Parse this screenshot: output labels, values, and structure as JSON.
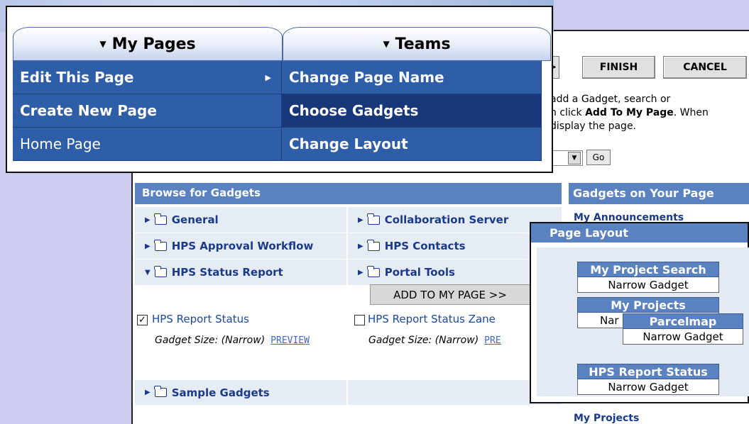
{
  "menu": {
    "tabs": [
      "My Pages",
      "Teams"
    ],
    "left_items": [
      "Edit This Page",
      "Create New Page",
      "Home Page"
    ],
    "right_items": [
      "Change Page Name",
      "Choose Gadgets",
      "Change Layout"
    ]
  },
  "wizard": {
    "back_partial": ">",
    "finish": "FINISH",
    "cancel": "CANCEL",
    "instructions_line1": "add a Gadget, search or",
    "instructions_line2a": "n click ",
    "instructions_line2b": "Add To My Page",
    "instructions_line2c": ". When",
    "instructions_line3": "display the page.",
    "go": "Go"
  },
  "browse": {
    "header": "Browse for Gadgets",
    "categories_left": [
      "General",
      "HPS Approval Workflow",
      "HPS Status Report"
    ],
    "categories_right": [
      "Collaboration Server",
      "HPS Contacts",
      "Portal Tools"
    ],
    "add_button": "ADD TO MY PAGE >>",
    "gadgets": [
      {
        "title": "HPS Report Status",
        "size": "Gadget Size: (Narrow)",
        "preview": "PREVIEW",
        "checked": true
      },
      {
        "title": "HPS Report Status Zane",
        "size": "Gadget Size: (Narrow)",
        "preview": "PRE",
        "checked": false
      }
    ],
    "sample": "Sample Gadgets"
  },
  "right_panel": {
    "header": "Gadgets on Your Page",
    "top_link": "My Announcements",
    "bottom_link": "My Projects"
  },
  "layout_popup": {
    "header": "Page Layout",
    "boxes": [
      {
        "title": "My Project Search",
        "sub": "Narrow Gadget"
      },
      {
        "title": "My Projects",
        "sub": "Nar"
      },
      {
        "title": "Parcelmap",
        "sub": "Narrow Gadget"
      },
      {
        "title": "HPS Report Status",
        "sub": "Narrow Gadget"
      }
    ]
  }
}
